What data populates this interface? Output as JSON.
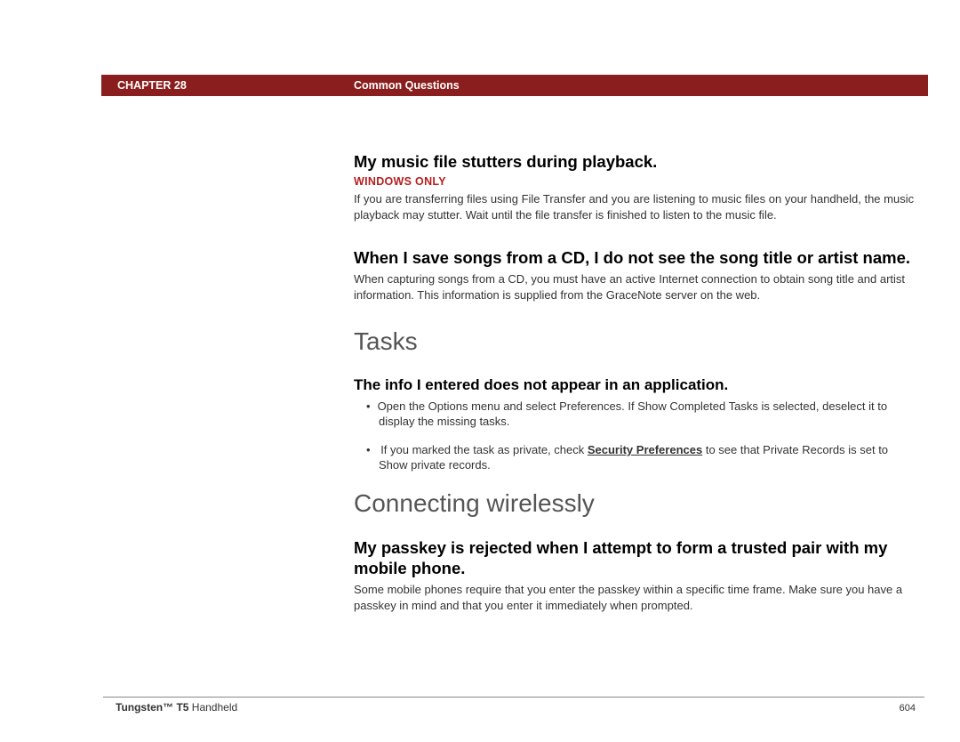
{
  "header": {
    "chapter": "CHAPTER 28",
    "section": "Common Questions"
  },
  "q1": {
    "heading": "My music file stutters during playback.",
    "label": "WINDOWS ONLY",
    "body": "If you are transferring files using File Transfer and you are listening to music files on your handheld, the music playback may stutter. Wait until the file transfer is finished to listen to the music file."
  },
  "q2": {
    "heading": "When I save songs from a CD, I do not see the song title or artist name.",
    "body": "When capturing songs from a CD, you must have an active Internet connection to obtain song title and artist information. This information is supplied from the GraceNote server on the web."
  },
  "tasks": {
    "title": "Tasks",
    "q3heading": "The info I entered does not appear in an application.",
    "bullet1": "Open the Options menu and select Preferences. If Show Completed Tasks is selected, deselect it to display the missing tasks.",
    "bullet2a": "If you marked the task as private, check ",
    "bullet2link": "Security Preferences",
    "bullet2b": " to see that Private Records is set to Show private records."
  },
  "wireless": {
    "title": "Connecting wirelessly",
    "q4heading": "My passkey is rejected when I attempt to form a trusted pair with my mobile phone.",
    "body": "Some mobile phones require that you enter the passkey within a specific time frame. Make sure you have a passkey in mind and that you enter it immediately when prompted."
  },
  "footer": {
    "product_bold": "Tungsten™ T5",
    "product_rest": " Handheld",
    "page": "604"
  }
}
